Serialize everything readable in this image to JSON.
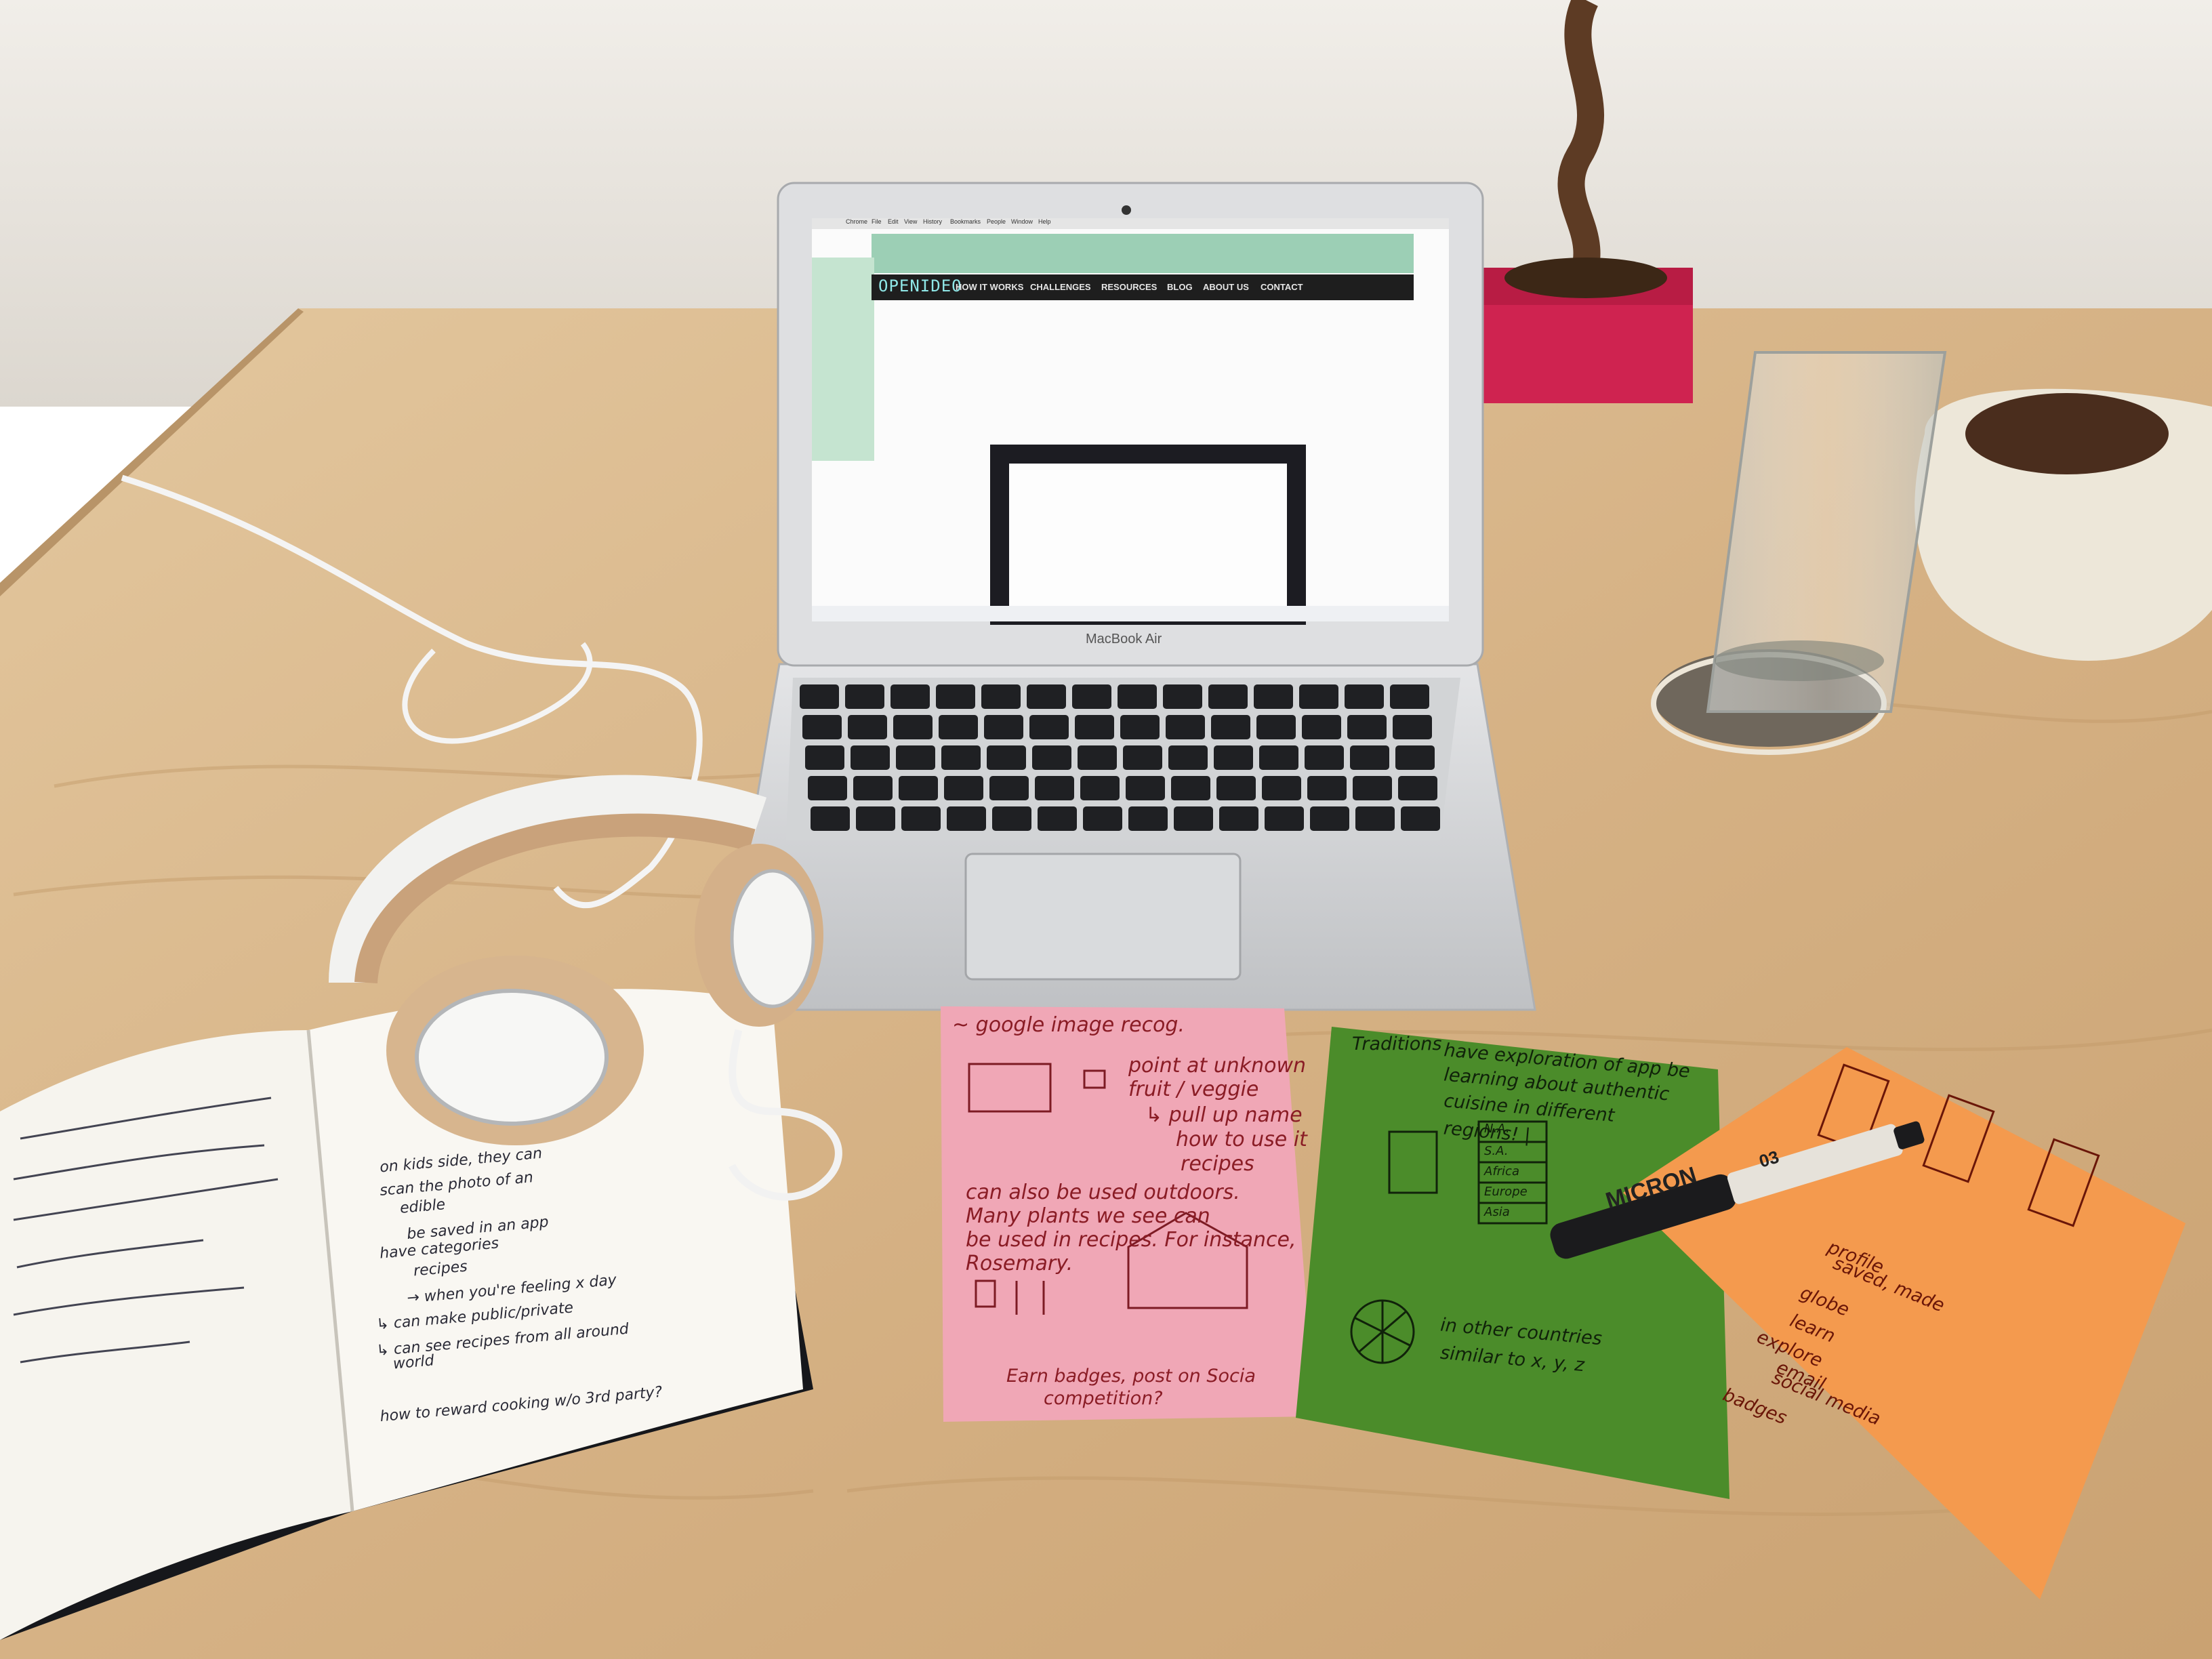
{
  "screen": {
    "site_logo": "OPENIDEO",
    "nav": [
      "HOW IT WORKS",
      "CHALLENGES",
      "RESOURCES",
      "BLOG",
      "ABOUT US",
      "CONTACT"
    ],
    "browser_menu": [
      "Chrome",
      "File",
      "Edit",
      "View",
      "History",
      "Bookmarks",
      "People",
      "Window",
      "Help"
    ]
  },
  "laptop": {
    "brand": "MacBook Air"
  },
  "pen": {
    "brand": "MICRON",
    "size": "03"
  },
  "pink_note": {
    "lines": [
      "~ google image recog.",
      "point at unknown",
      "fruit / veggie",
      "↳ pull up name",
      "how to use it",
      "recipes",
      "can also be used outdoors.",
      "Many plants we see can",
      "be used in recipes. For instance,",
      "Rosemary.",
      "Earn badges, post on Socia",
      "competition?"
    ]
  },
  "green_note": {
    "lines": [
      "Traditions",
      "have exploration of app be",
      "learning about authentic",
      "cuisine in different",
      "regions! |",
      "N.A.",
      "S.A.",
      "Africa",
      "Europe",
      "Asia",
      "in other countries",
      "similar to x, y, z"
    ]
  },
  "orange_note": {
    "lines": [
      "profile",
      "saved, made",
      "globe",
      "learn",
      "explore",
      "email",
      "social media",
      "badges"
    ]
  },
  "notebook": {
    "lines": [
      "on kids side, they can",
      "scan the photo of an",
      "edible",
      "be saved in an app",
      "have categories",
      "recipes",
      "→ when you're feeling x day",
      "↳ can make public/private",
      "↳ can see recipes from all around",
      "world",
      "how to reward cooking w/o 3rd party?"
    ]
  },
  "colors": {
    "wall": "#e7e3dc",
    "desk": "#d9b98d",
    "pink_paper": "#f0a7b6",
    "green_paper": "#4b8c2a",
    "orange_paper": "#f49a4e",
    "pot": "#cf2350",
    "screen_nav": "#1e1e1e"
  }
}
